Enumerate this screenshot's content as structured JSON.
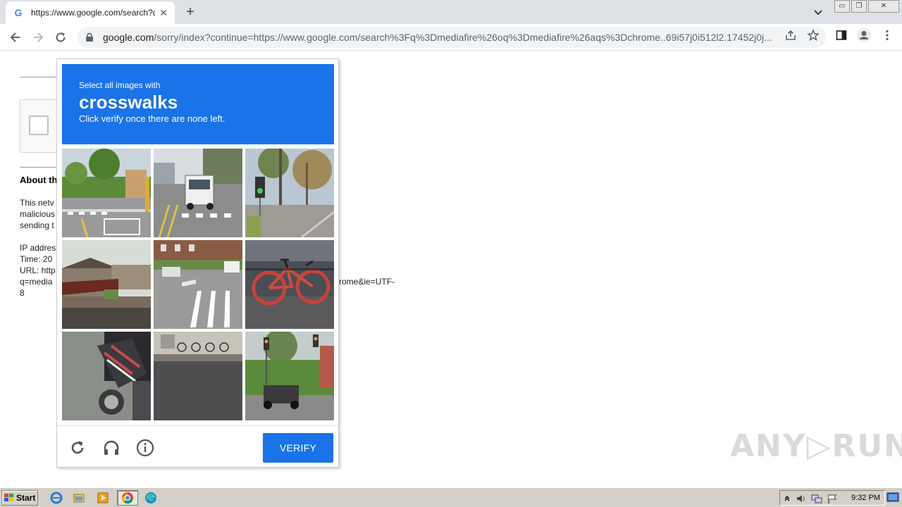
{
  "browser": {
    "tab_title": "https://www.google.com/search?q=",
    "tab_close": "✕",
    "new_tab": "+",
    "url_domain": "google.com",
    "url_path": "/sorry/index?continue=https://www.google.com/search%3Fq%3Dmediafire%26oq%3Dmediafire%26aqs%3Dchrome..69i57j0i512l2.17452j0j..."
  },
  "window_controls": {
    "minimize": "▭",
    "restore": "❐",
    "close": "✕"
  },
  "page": {
    "about_title": "About th",
    "paragraph_lines": [
      "This netv",
      "malicious",
      "sending t"
    ],
    "ip_line": "IP addres",
    "time_line": "Time: 20",
    "url_line": "URL: http",
    "q_line": "q=media",
    "tail_line": "8",
    "overflow_text": "rome&ie=UTF-"
  },
  "captcha": {
    "instruction_small": "Select all images with",
    "instruction_big": "crosswalks",
    "instruction_sub": "Click verify once there are none left.",
    "verify_label": "VERIFY",
    "tiles": [
      {
        "row": 1,
        "col": 1,
        "subject": "street crosswalk with trees"
      },
      {
        "row": 1,
        "col": 2,
        "subject": "white truck on crosswalk"
      },
      {
        "row": 1,
        "col": 3,
        "subject": "traffic light and palm trees"
      },
      {
        "row": 2,
        "col": 1,
        "subject": "houses and fence"
      },
      {
        "row": 2,
        "col": 2,
        "subject": "crosswalk on street"
      },
      {
        "row": 2,
        "col": 3,
        "subject": "red bicycle"
      },
      {
        "row": 3,
        "col": 1,
        "subject": "motorcycle close-up"
      },
      {
        "row": 3,
        "col": 2,
        "subject": "parked bicycles"
      },
      {
        "row": 3,
        "col": 3,
        "subject": "traffic lights and car"
      }
    ]
  },
  "watermark": "ANY▷RUN",
  "taskbar": {
    "start_label": "Start",
    "clock": "9:32 PM"
  },
  "colors": {
    "captcha_blue": "#1a73e8",
    "chrome_tabstrip": "#dee1e6",
    "taskbar": "#d4d0c8"
  }
}
